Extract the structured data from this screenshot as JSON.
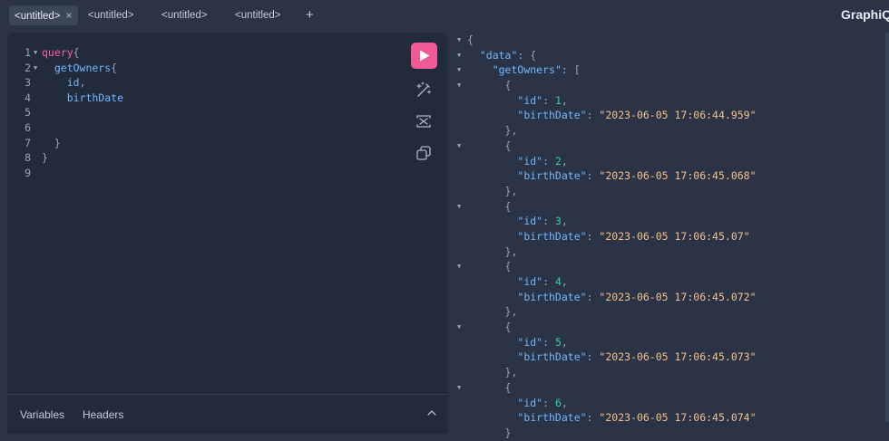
{
  "tabs": [
    {
      "label": "<untitled>",
      "active": true,
      "close": "×"
    },
    {
      "label": "<untitled>",
      "active": false
    },
    {
      "label": "<untitled>",
      "active": false
    },
    {
      "label": "<untitled>",
      "active": false
    }
  ],
  "add_tab": "+",
  "brand": "GraphiQL",
  "query_lines": [
    {
      "n": "1",
      "fold": true,
      "parts": [
        [
          "kw",
          "query"
        ],
        [
          "pun",
          "{"
        ]
      ]
    },
    {
      "n": "2",
      "fold": true,
      "parts": [
        [
          "fld",
          "  getOwners"
        ],
        [
          "pun",
          "{"
        ]
      ]
    },
    {
      "n": "3",
      "fold": false,
      "parts": [
        [
          "fld",
          "    id"
        ],
        [
          "pun",
          ","
        ]
      ]
    },
    {
      "n": "4",
      "fold": false,
      "parts": [
        [
          "fld",
          "    birthDate"
        ]
      ]
    },
    {
      "n": "5",
      "fold": false,
      "parts": []
    },
    {
      "n": "6",
      "fold": false,
      "parts": []
    },
    {
      "n": "7",
      "fold": false,
      "parts": [
        [
          "pun",
          "  }"
        ]
      ]
    },
    {
      "n": "8",
      "fold": false,
      "parts": [
        [
          "pun",
          "}"
        ]
      ]
    },
    {
      "n": "9",
      "fold": false,
      "parts": []
    }
  ],
  "tools": [
    "run-icon",
    "prettify-icon",
    "merge-fragments-icon",
    "copy-icon"
  ],
  "bottom_tabs": {
    "variables": "Variables",
    "headers": "Headers"
  },
  "result": {
    "data_key": "\"data\"",
    "owners_key": "\"getOwners\"",
    "id_key": "\"id\"",
    "birth_key": "\"birthDate\"",
    "owners": [
      {
        "id": "1",
        "birthDate": "\"2023-06-05 17:06:44.959\""
      },
      {
        "id": "2",
        "birthDate": "\"2023-06-05 17:06:45.068\""
      },
      {
        "id": "3",
        "birthDate": "\"2023-06-05 17:06:45.07\""
      },
      {
        "id": "4",
        "birthDate": "\"2023-06-05 17:06:45.072\""
      },
      {
        "id": "5",
        "birthDate": "\"2023-06-05 17:06:45.073\""
      },
      {
        "id": "6",
        "birthDate": "\"2023-06-05 17:06:45.074\""
      }
    ]
  },
  "colors": {
    "accent": "#f05a95",
    "keyword": "#ff5fa2",
    "field": "#6fb8ff",
    "string": "#f5c08a",
    "number": "#2fd3a5"
  }
}
